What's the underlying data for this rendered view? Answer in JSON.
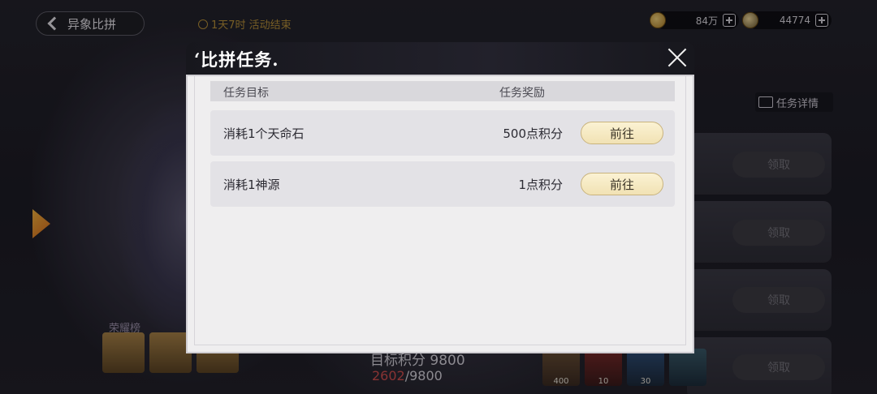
{
  "topbar": {
    "back_label": "异象比拼",
    "timer_text": "1天7时 活动结束",
    "currency1_value": "84万",
    "currency2_value": "44774"
  },
  "side_panel": {
    "detail_label": "任务详情",
    "claim_label": "领取"
  },
  "background": {
    "honor_label": "荣耀榜",
    "target_text": "目标积分 9800",
    "progress_current": "2602",
    "progress_total": "/9800",
    "item_counts": [
      "400",
      "10",
      "30",
      ""
    ]
  },
  "modal": {
    "title": "‘比拼任务.",
    "col_goal": "任务目标",
    "col_reward": "任务奖励",
    "tasks": [
      {
        "goal": "消耗1个天命石",
        "reward": "500点积分",
        "button": "前往"
      },
      {
        "goal": "消耗1神源",
        "reward": "1点积分",
        "button": "前往"
      }
    ]
  }
}
